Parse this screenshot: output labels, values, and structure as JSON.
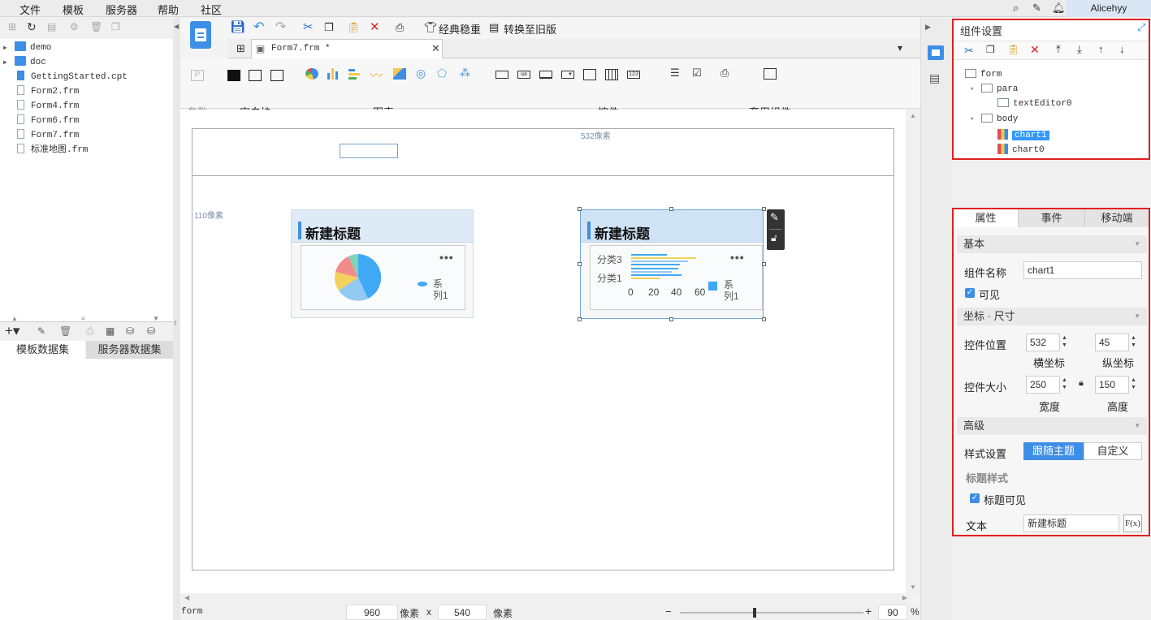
{
  "menu": {
    "items": [
      "文件",
      "模板",
      "服务器",
      "帮助",
      "社区"
    ],
    "user": "Alicehyy"
  },
  "left": {
    "files": [
      {
        "name": "demo",
        "type": "folder"
      },
      {
        "name": "doc",
        "type": "folder"
      },
      {
        "name": "GettingStarted.cpt",
        "type": "cpt"
      },
      {
        "name": "Form2.frm",
        "type": "frm"
      },
      {
        "name": "Form4.frm",
        "type": "frm"
      },
      {
        "name": "Form6.frm",
        "type": "frm"
      },
      {
        "name": "Form7.frm",
        "type": "frm"
      },
      {
        "name": "标准地图.frm",
        "type": "frm"
      }
    ],
    "dataset_tabs": [
      "模板数据集",
      "服务器数据集"
    ]
  },
  "toolbar": {
    "classic_label": "经典稳重",
    "convert_label": "转换至旧版"
  },
  "doc_tab": {
    "name": "Form7.frm *"
  },
  "widget_groups": {
    "param": "参数",
    "blank": "空白块",
    "chart": "图表",
    "control": "控件",
    "template": "套用组件"
  },
  "canvas": {
    "ruler_x_label": "532像素",
    "ruler_y_label": "110像素",
    "chart0_title": "新建标题",
    "chart1_title": "新建标题",
    "pie_legend": "系列1",
    "bar_legend": "系列1",
    "bar_categories": [
      "分类3",
      "分类1"
    ],
    "bar_axis_ticks": [
      "0",
      "20",
      "40",
      "60"
    ]
  },
  "status": {
    "name": "form",
    "width": "960",
    "unit1": "像素",
    "x": "x",
    "height": "540",
    "unit2": "像素",
    "zoom": "90",
    "percent": "%",
    "minus": "−",
    "plus": "+"
  },
  "component_panel": {
    "title": "组件设置",
    "tree": [
      {
        "label": "form",
        "level": 0
      },
      {
        "label": "para",
        "level": 1
      },
      {
        "label": "textEditor0",
        "level": 2
      },
      {
        "label": "body",
        "level": 1
      },
      {
        "label": "chart1",
        "level": 2,
        "selected": true
      },
      {
        "label": "chart0",
        "level": 2
      }
    ]
  },
  "props": {
    "tabs": [
      "属性",
      "事件",
      "移动端"
    ],
    "section_basic": "基本",
    "name_label": "组件名称",
    "name_value": "chart1",
    "visible_label": "可见",
    "section_coord": "坐标 · 尺寸",
    "pos_label": "控件位置",
    "pos_x": "532",
    "pos_y": "45",
    "x_caption": "横坐标",
    "y_caption": "纵坐标",
    "size_label": "控件大小",
    "width": "250",
    "height": "150",
    "w_caption": "宽度",
    "h_caption": "高度",
    "section_adv": "高级",
    "style_label": "样式设置",
    "style_follow": "跟随主题",
    "style_custom": "自定义",
    "title_style": "标题样式",
    "title_visible": "标题可见",
    "text_label": "文本",
    "text_value": "新建标题",
    "fx": "F(x)"
  },
  "colors": {
    "accent": "#3d8ee6",
    "highlight_border": "#e02020",
    "selected": "#3399ff"
  }
}
